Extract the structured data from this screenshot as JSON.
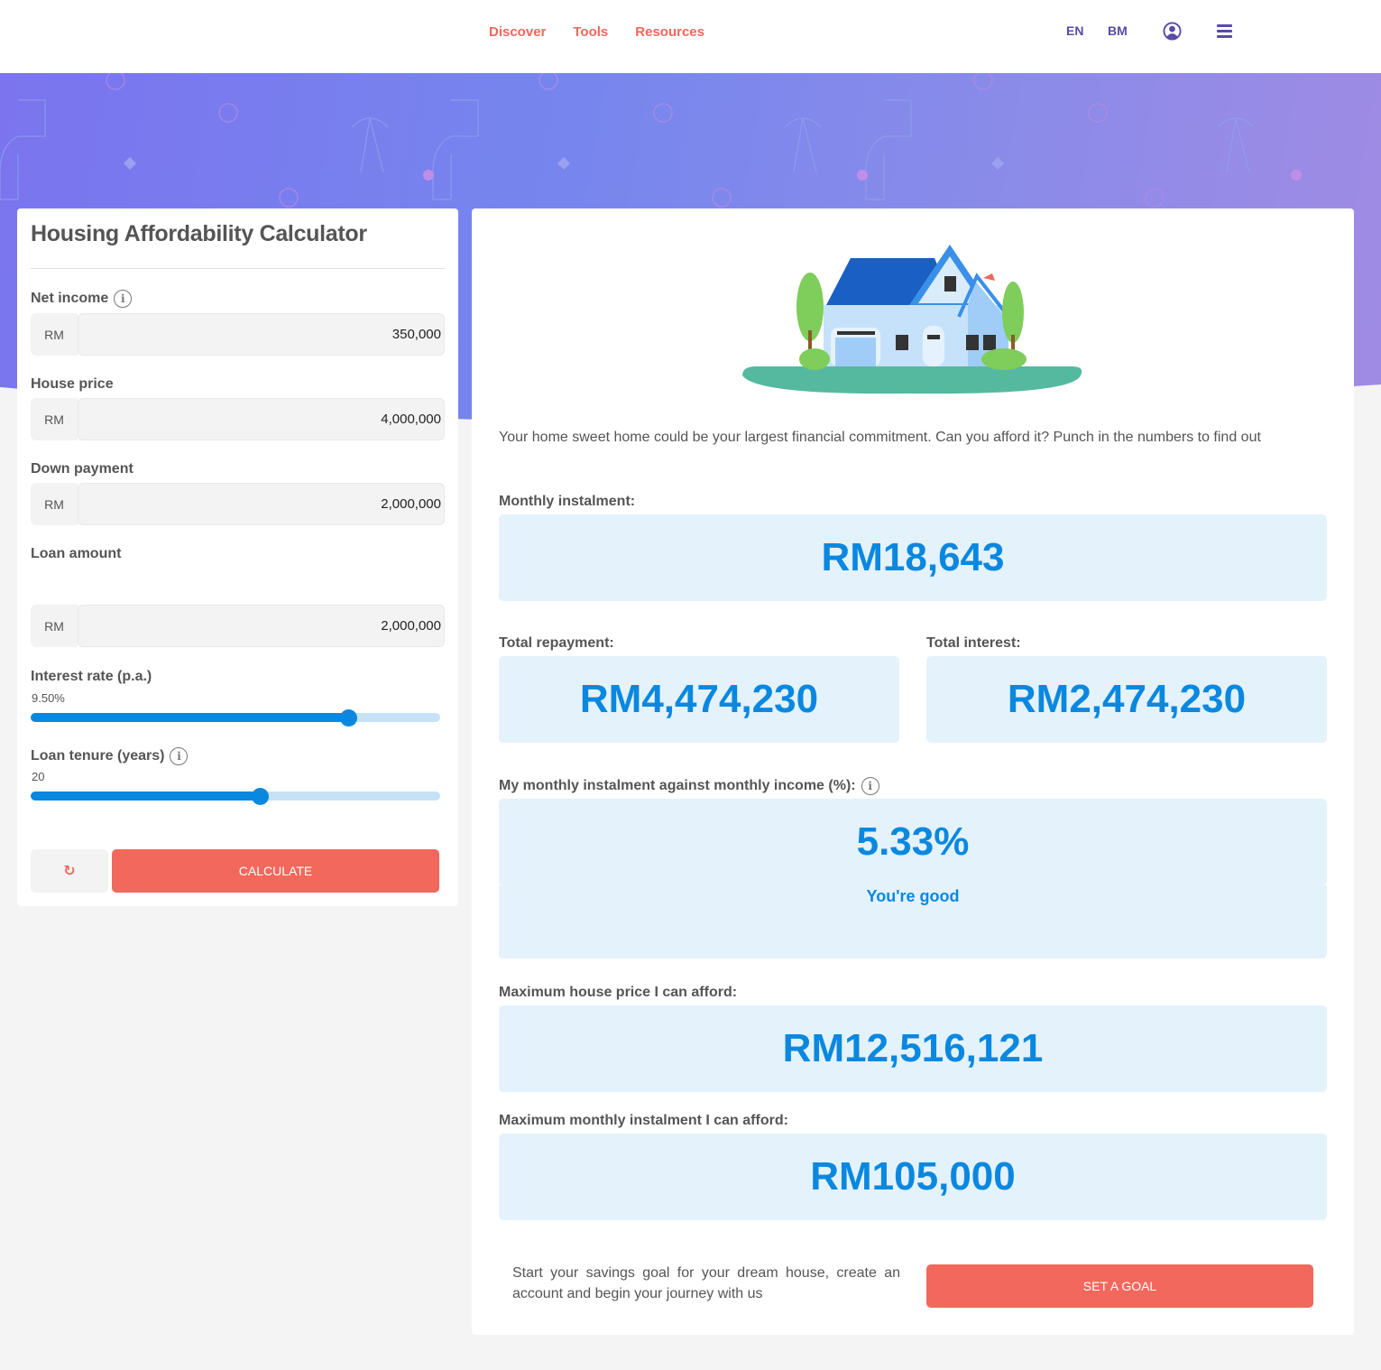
{
  "header": {
    "nav": [
      {
        "label": "Discover"
      },
      {
        "label": "Tools"
      },
      {
        "label": "Resources"
      }
    ],
    "languages": [
      "EN",
      "BM"
    ],
    "icons": {
      "account": "user-circle-icon",
      "menu": "hamburger-menu-icon"
    },
    "colors": {
      "nav": "#f2665a",
      "icons": "#5a4aa8"
    }
  },
  "calculator": {
    "title": "Housing Affordability Calculator",
    "fields": {
      "net_income": {
        "label": "Net income",
        "prefix": "RM",
        "value": "350,000",
        "has_info": true
      },
      "house_price": {
        "label": "House price",
        "prefix": "RM",
        "value": "4,000,000"
      },
      "down_payment": {
        "label": "Down payment",
        "prefix": "RM",
        "value": "2,000,000"
      },
      "loan_amount": {
        "label": "Loan amount",
        "prefix": "RM",
        "value": "2,000,000"
      }
    },
    "interest_rate": {
      "label": "Interest rate (p.a.)",
      "value_text": "9.50%",
      "fill_fraction": 0.775
    },
    "loan_tenure": {
      "label": "Loan tenure (years)",
      "value_text": "20",
      "fill_fraction": 0.56,
      "has_info": true
    },
    "reset_icon": "refresh-icon",
    "calculate_label": "CALCULATE"
  },
  "results": {
    "intro": "Your home sweet home could be your largest financial commitment. Can you afford it? Punch in the numbers to find out",
    "monthly_instalment": {
      "label": "Monthly instalment:",
      "value": "RM18,643"
    },
    "total_repayment": {
      "label": "Total repayment:",
      "value": "RM4,474,230"
    },
    "total_interest": {
      "label": "Total interest:",
      "value": "RM2,474,230"
    },
    "ratio": {
      "label": "My monthly instalment against monthly income (%):",
      "value": "5.33%",
      "status": "You're good"
    },
    "max_house_price": {
      "label": "Maximum house price I can afford:",
      "value": "RM12,516,121"
    },
    "max_monthly_instalment": {
      "label": "Maximum monthly instalment I can afford:",
      "value": "RM105,000"
    },
    "cta_text": "Start your savings goal for your dream house, create an account and begin your journey with us",
    "goal_label": "SET A GOAL",
    "colors": {
      "value": "#0a88e0",
      "box": "#e4f2fc",
      "button": "#f3685c"
    }
  }
}
